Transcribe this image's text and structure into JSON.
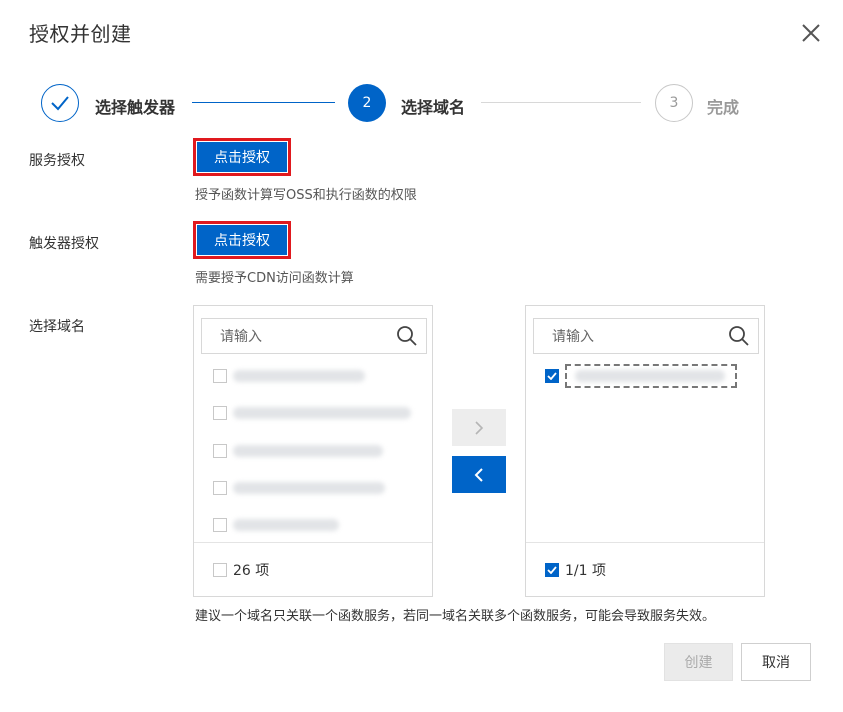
{
  "dialog": {
    "title": "授权并创建"
  },
  "steps": [
    {
      "label": "选择触发器",
      "state": "done"
    },
    {
      "number": "2",
      "label": "选择域名",
      "state": "active"
    },
    {
      "number": "3",
      "label": "完成",
      "state": "pending"
    }
  ],
  "service_auth": {
    "label": "服务授权",
    "button": "点击授权",
    "hint": "授予函数计算写OSS和执行函数的权限"
  },
  "trigger_auth": {
    "label": "触发器授权",
    "button": "点击授权",
    "hint": "需要授予CDN访问函数计算"
  },
  "domain_select": {
    "label": "选择域名",
    "source": {
      "placeholder": "请输入",
      "count_label": "26 项",
      "checked": false
    },
    "target": {
      "placeholder": "请输入",
      "count_label": "1/1 项",
      "checked": true
    },
    "note": "建议一个域名只关联一个函数服务，若同一域名关联多个函数服务，可能会导致服务失效。"
  },
  "footer": {
    "create_label": "创建",
    "cancel_label": "取消"
  },
  "colors": {
    "primary": "#0064c8",
    "highlight_border": "#e0191e"
  }
}
